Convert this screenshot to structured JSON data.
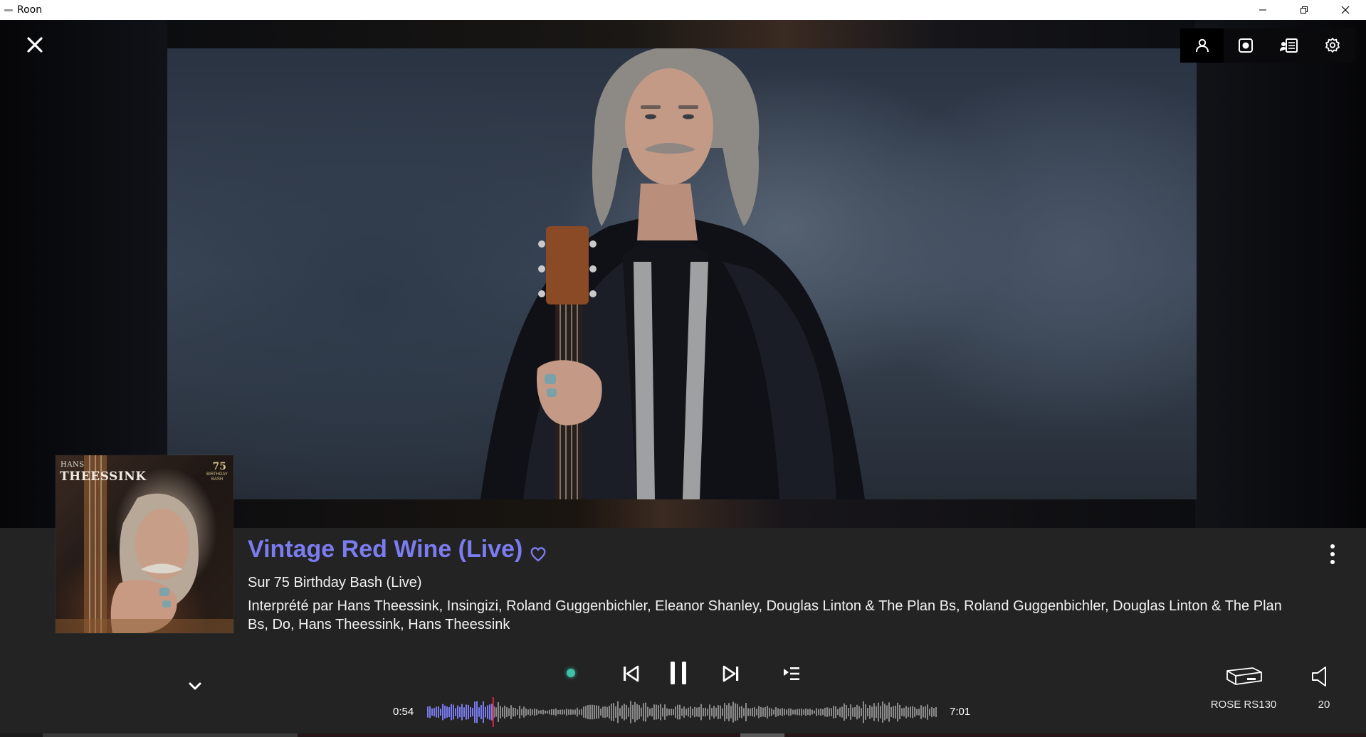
{
  "window": {
    "title": "Roon",
    "controls": {
      "minimize_icon": "minimize-icon",
      "maximize_icon": "restore-icon",
      "close_icon": "close-icon"
    }
  },
  "toolbar": {
    "items": [
      {
        "name": "artist",
        "icon": "person-icon",
        "active": true
      },
      {
        "name": "album",
        "icon": "album-icon",
        "active": false
      },
      {
        "name": "lyrics",
        "icon": "lyrics-icon",
        "active": false
      },
      {
        "name": "settings",
        "icon": "gear-icon",
        "active": false
      }
    ]
  },
  "album_art": {
    "first_name": "HANS",
    "surname": "THEESSINK",
    "badge_number": "75",
    "badge_text": "BIRTHDAY BASH"
  },
  "now_playing": {
    "title": "Vintage Red Wine (Live)",
    "album": "Sur 75 Birthday Bash (Live)",
    "artists": "Interprété par Hans Theessink, Insingizi, Roland Guggenbichler, Eleanor Shanley, Douglas Linton & The Plan Bs, Roland Guggenbichler, Douglas Linton & The Plan Bs, Do, Hans Theessink, Hans Theessink",
    "favorite": false
  },
  "transport": {
    "elapsed": "0:54",
    "total": "7:01",
    "progress_fraction": 0.128,
    "state": "playing"
  },
  "output": {
    "device_name": "ROSE RS130",
    "volume": "20"
  },
  "colors": {
    "accent": "#7b7cf0",
    "zone_dot": "#3ec1a4",
    "bar_bg": "#232323",
    "progress_marker": "#e0204a"
  }
}
